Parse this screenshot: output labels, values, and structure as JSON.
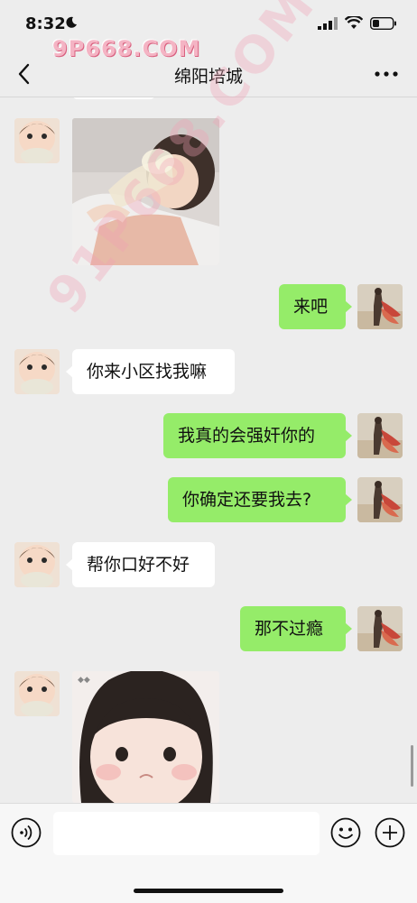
{
  "status": {
    "time": "8:32"
  },
  "watermark": {
    "top": "9P668.COM",
    "diagonal": "91P668.COM"
  },
  "header": {
    "title": "绵阳培城"
  },
  "messages": [
    {
      "from": "them",
      "type": "image",
      "icon": "baby-drinking-photo"
    },
    {
      "from": "me",
      "type": "text",
      "text": "来吧"
    },
    {
      "from": "them",
      "type": "text",
      "text": "你来小区找我嘛"
    },
    {
      "from": "me",
      "type": "text",
      "text": "我真的会强奸你的"
    },
    {
      "from": "me",
      "type": "text",
      "text": "你确定还要我去?"
    },
    {
      "from": "them",
      "type": "text",
      "text": "帮你口好不好"
    },
    {
      "from": "me",
      "type": "text",
      "text": "那不过瘾"
    },
    {
      "from": "them",
      "type": "image",
      "icon": "baby-face-sticker"
    }
  ],
  "input": {
    "value": "",
    "placeholder": ""
  },
  "colors": {
    "my_bubble": "#95ec69",
    "their_bubble": "#ffffff",
    "background": "#ededed"
  }
}
